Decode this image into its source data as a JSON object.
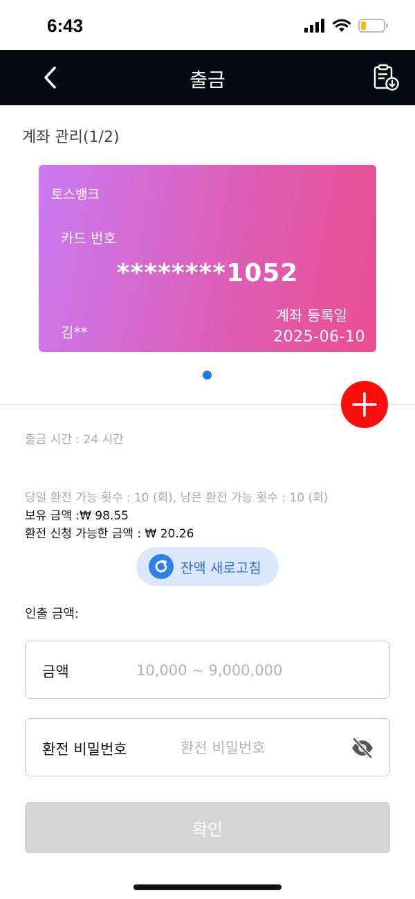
{
  "status_bar": {
    "time": "6:43"
  },
  "nav": {
    "title": "출금",
    "back_icon": "chevron-left-icon",
    "history_icon": "clipboard-download-icon"
  },
  "account": {
    "section_title": "계좌 관리(1/2)",
    "card": {
      "bank_name": "토스뱅크",
      "number_label": "카드 번호",
      "number": "********1052",
      "holder": "김**",
      "registered_label": "계좌 등록일",
      "registered_date": "2025-06-10",
      "gradient_start": "#c97af0",
      "gradient_end": "#ea4e8f"
    },
    "page_current": 1,
    "page_total": 2
  },
  "info": {
    "withdraw_time": "출금 시간 :  24 시간",
    "exchange_count": "당일 환전 가능 횟수 : 10 (회), 남은 환전 가능 횟수 : 10 (회)",
    "balance": "보유 금액 :₩ 98.55",
    "available": "환전 신청 가능한 금액 : ₩ 20.26"
  },
  "refresh": {
    "label": "잔액 새로고침",
    "icon": "refresh-icon"
  },
  "form": {
    "withdraw_amount_label": "인출 금액:",
    "amount": {
      "label": "금액",
      "value": "",
      "placeholder": "10,000 ~ 9,000,000"
    },
    "password": {
      "label": "환전 비밀번호",
      "value": "",
      "placeholder": "환전 비밀번호",
      "toggle_icon": "eye-off-icon"
    },
    "confirm_label": "확인"
  },
  "colors": {
    "nav_background": "#040a14",
    "add_button": "#fa0f0f",
    "accent_blue": "#2f7fe8",
    "disabled_button": "#d5d5d5"
  }
}
